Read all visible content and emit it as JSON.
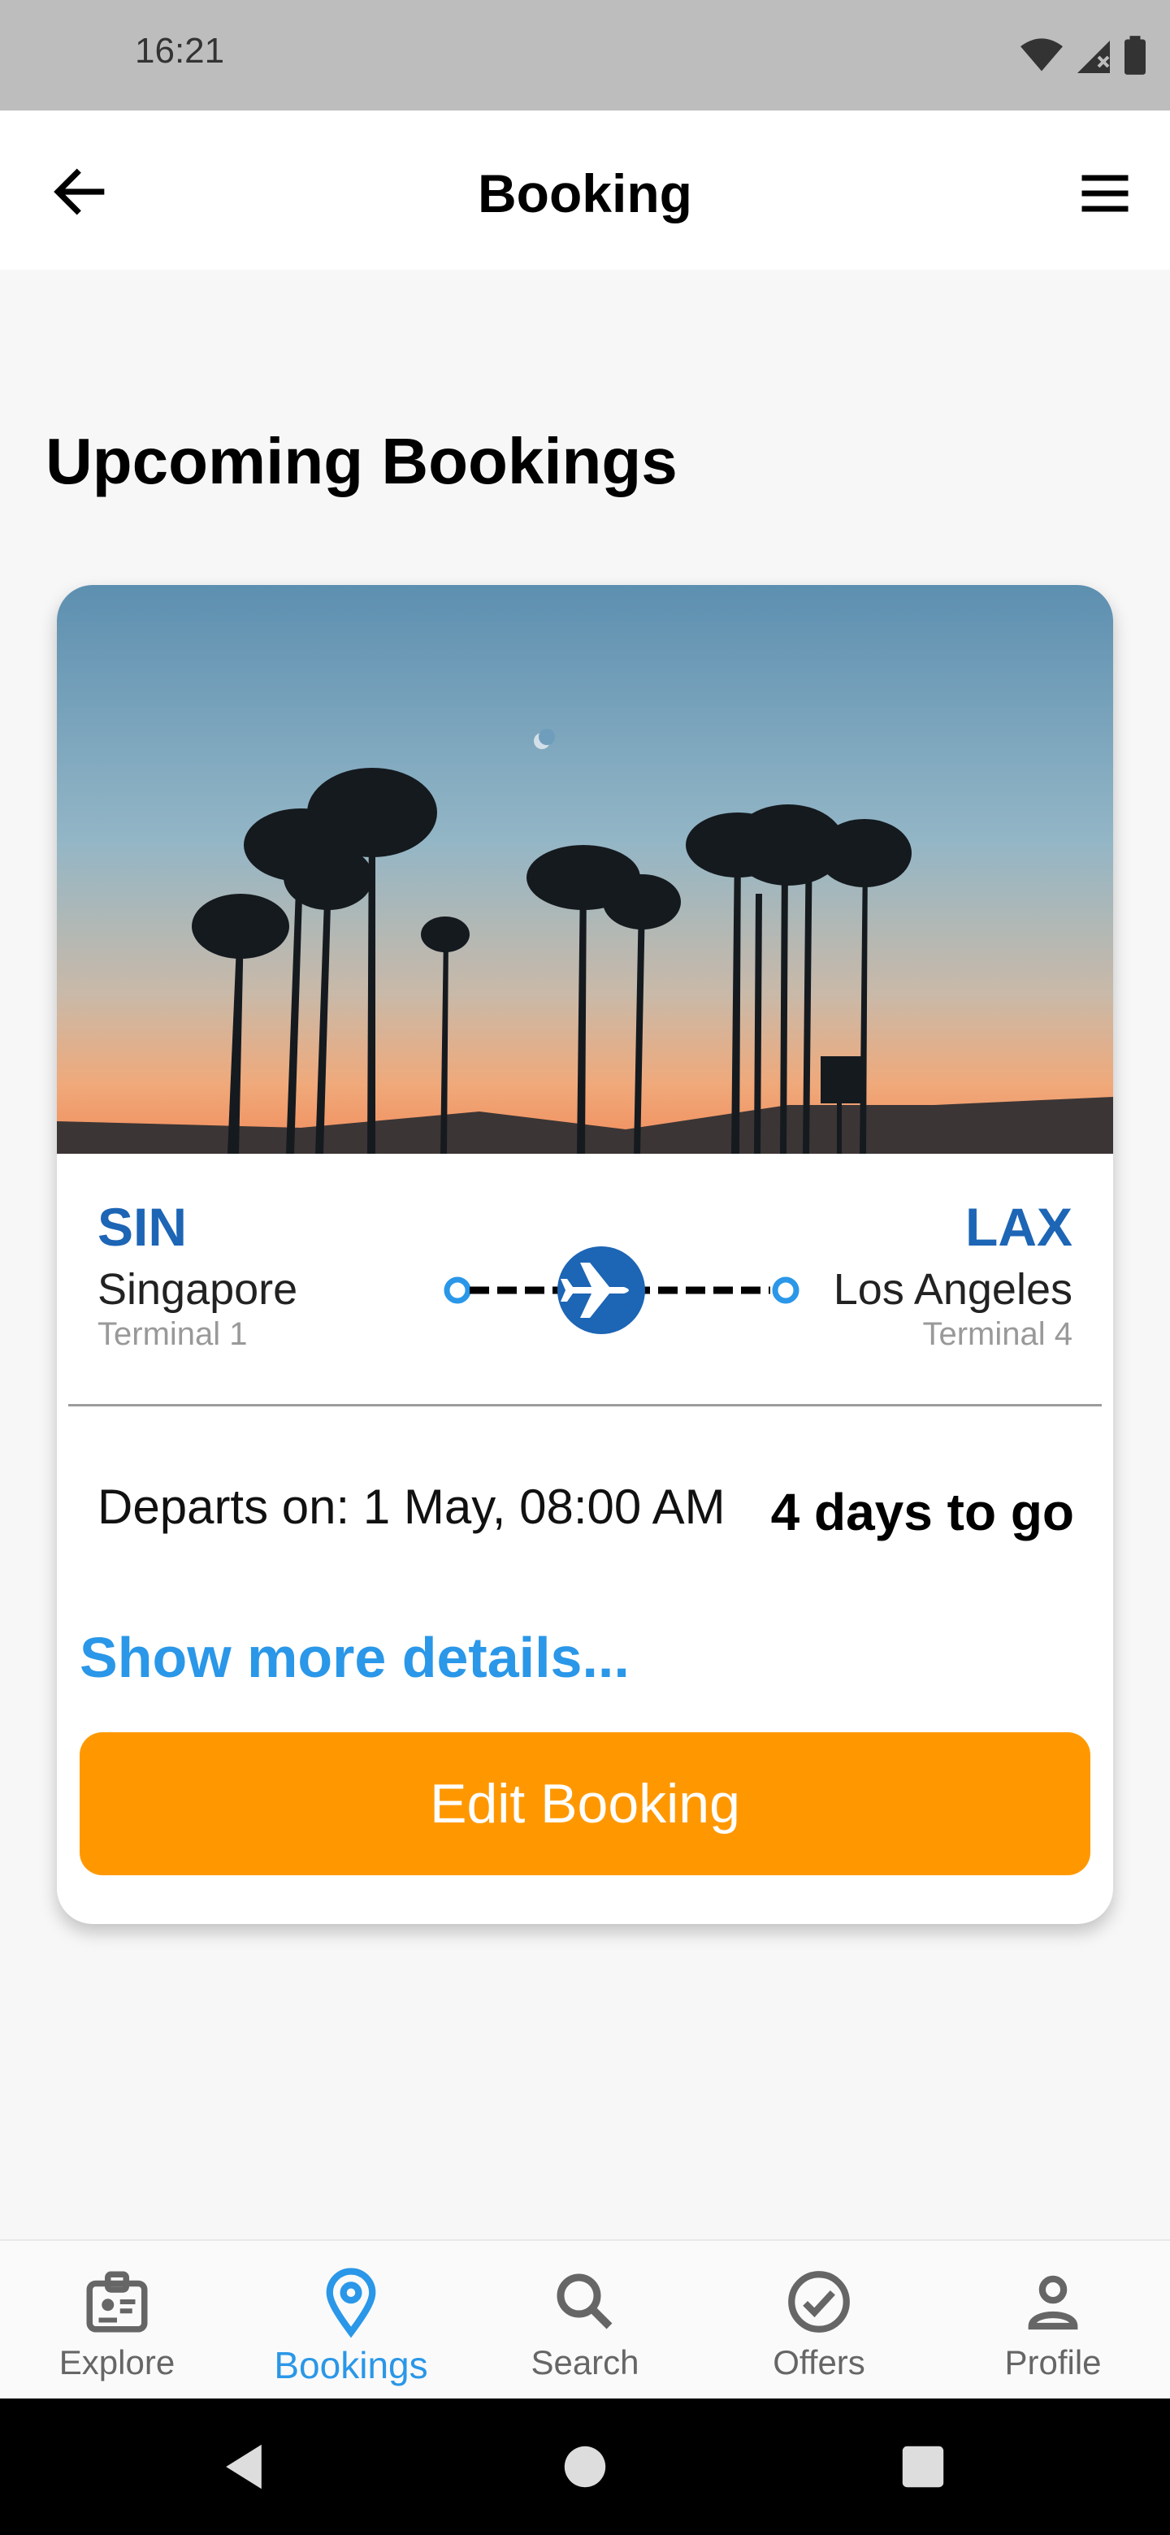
{
  "status": {
    "time": "16:21"
  },
  "appbar": {
    "title": "Booking"
  },
  "section": {
    "title": "Upcoming Bookings"
  },
  "booking": {
    "origin": {
      "code": "SIN",
      "city": "Singapore",
      "terminal": "Terminal 1"
    },
    "destination": {
      "code": "LAX",
      "city": "Los Angeles",
      "terminal": "Terminal 4"
    },
    "departs": "Departs on: 1 May, 08:00 AM",
    "countdown": "4 days to go",
    "more_link": "Show more details...",
    "edit_label": "Edit Booking"
  },
  "nav": {
    "items": [
      {
        "label": "Explore",
        "icon": "id-badge-icon"
      },
      {
        "label": "Bookings",
        "icon": "location-pin-icon",
        "active": true
      },
      {
        "label": "Search",
        "icon": "search-icon"
      },
      {
        "label": "Offers",
        "icon": "check-circle-icon"
      },
      {
        "label": "Profile",
        "icon": "person-icon"
      }
    ]
  },
  "colors": {
    "accent": "#2a97e8",
    "brand_blue": "#1d65b5",
    "primary_button": "#ff9800"
  }
}
